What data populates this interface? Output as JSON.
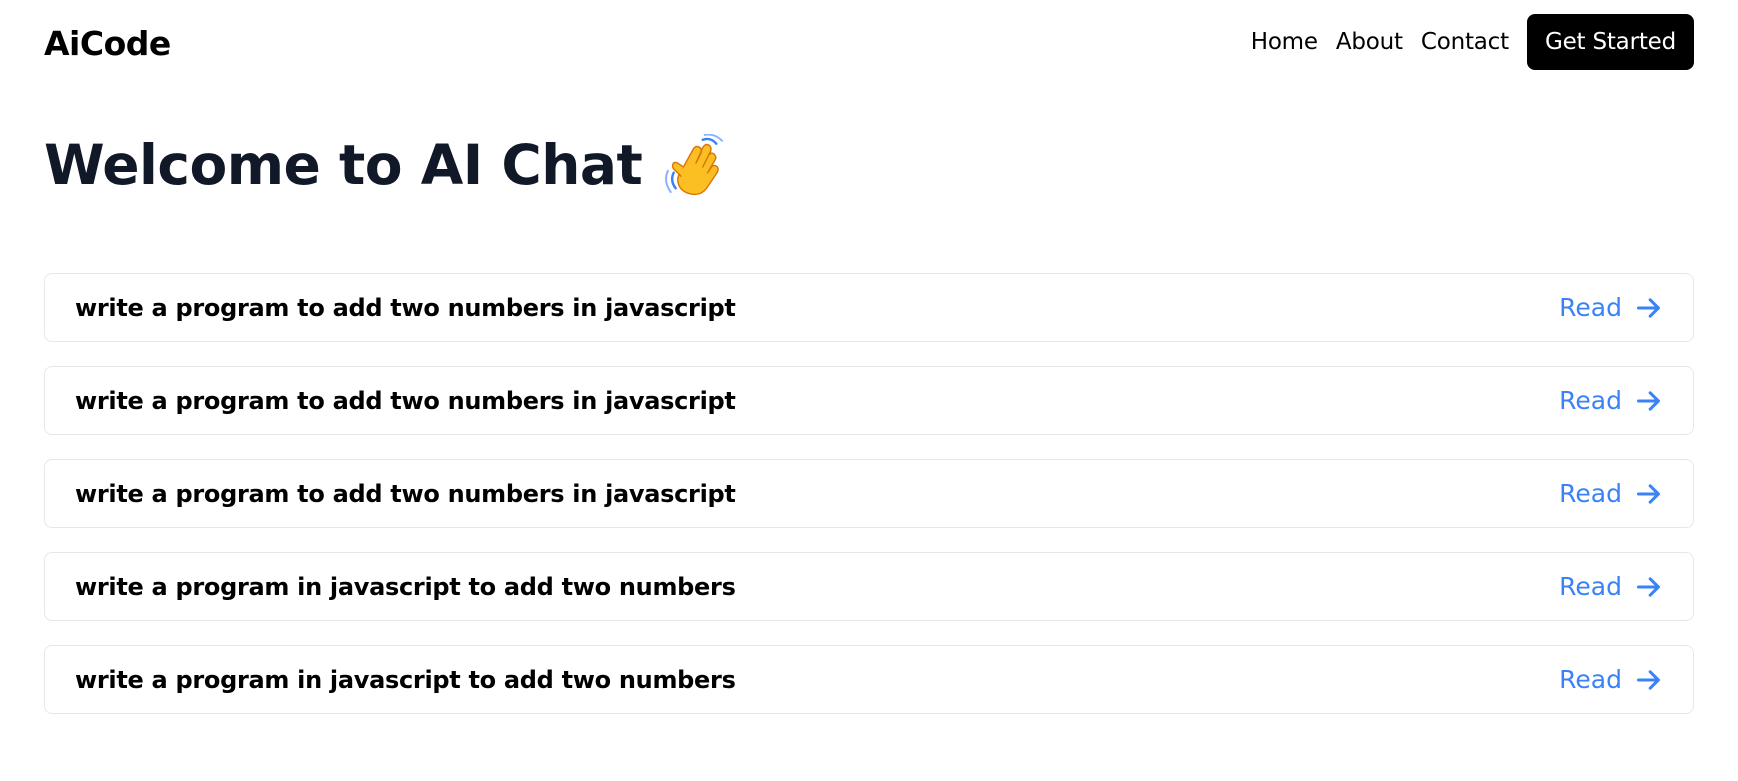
{
  "header": {
    "logo": "AiCode",
    "nav": [
      {
        "label": "Home"
      },
      {
        "label": "About"
      },
      {
        "label": "Contact"
      }
    ],
    "cta_label": "Get Started"
  },
  "main": {
    "title": "Welcome to AI Chat",
    "title_icon": "waving-hand-icon",
    "read_label": "Read",
    "read_icon": "arrow-right-icon",
    "accent_color": "#3b82f6",
    "chats": [
      {
        "title": "write a program to add two numbers in javascript"
      },
      {
        "title": "write a program to add two numbers in javascript"
      },
      {
        "title": "write a program to add two numbers in javascript"
      },
      {
        "title": "write a program in javascript to add two numbers"
      },
      {
        "title": "write a program in javascript to add two numbers"
      }
    ]
  }
}
